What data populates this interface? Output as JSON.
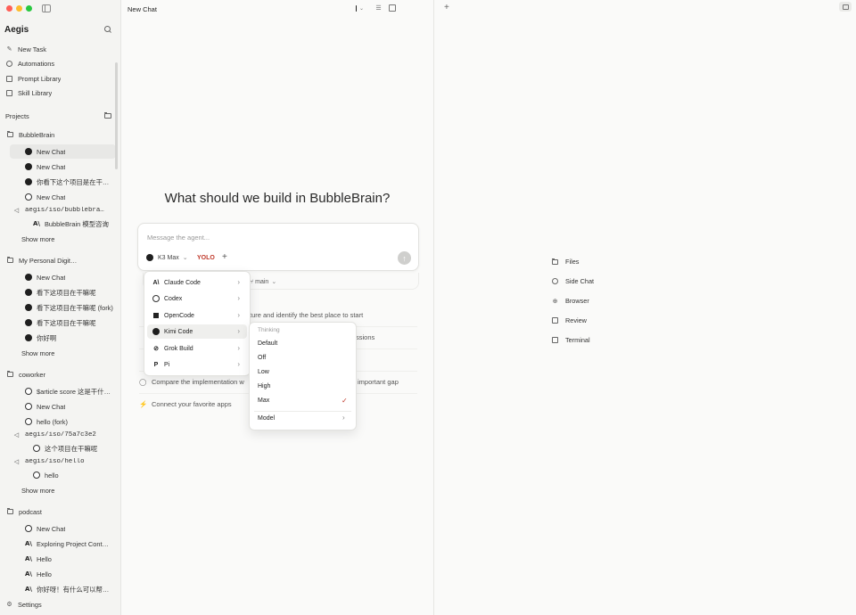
{
  "app": {
    "name": "Aegis"
  },
  "nav": [
    "New Task",
    "Automations",
    "Prompt Library",
    "Skill Library"
  ],
  "projects_label": "Projects",
  "sidebar": {
    "bubblebrain": {
      "name": "BubbleBrain",
      "chats": [
        "New Chat",
        "New Chat",
        "你看下这个项目是在干嘛呢",
        "New Chat"
      ],
      "worktree": "aegis/iso/bubblebra…",
      "worktree_chat": "BubbleBrain 模型咨询",
      "show_more": "Show more"
    },
    "personal": {
      "name": "My Personal Digit…",
      "chats": [
        "New Chat",
        "看下这项目在干嘛呢",
        "看下这项目在干嘛呢 (fork)",
        "看下这项目在干嘛呢",
        "你好啊"
      ],
      "show_more": "Show more"
    },
    "coworker": {
      "name": "coworker",
      "chats": [
        "$article score 这是干什…",
        "New Chat",
        "hello (fork)"
      ],
      "worktree1": "aegis/iso/75a7c3e2",
      "worktree1_chat": "这个项目在干嘛呢",
      "worktree2": "aegis/iso/hello",
      "worktree2_chat": "hello",
      "show_more": "Show more"
    },
    "podcast": {
      "name": "podcast",
      "chats": [
        "New Chat",
        "Exploring Project Cont…",
        "Hello",
        "Hello",
        "你好呀！有什么可以帮你…"
      ]
    },
    "settings": "Settings"
  },
  "header": {
    "title": "New Chat"
  },
  "hero": {
    "title": "What should we build in BubbleBrain?"
  },
  "composer": {
    "placeholder": "Message the agent...",
    "model": "K3 Max",
    "mode": "YOLO",
    "plus": "+",
    "branch": "main"
  },
  "suggestions": [
    "ture and identify the best place to start",
    "ssions",
    "",
    "Compare the implementation w",
    "Connect your favorite apps"
  ],
  "suggestion_tail": "important gap",
  "agent_menu": [
    "Claude Code",
    "Codex",
    "OpenCode",
    "Kimi Code",
    "Grok Build",
    "Pi"
  ],
  "thinking_menu": {
    "heading": "Thinking",
    "options": [
      "Default",
      "Off",
      "Low",
      "High",
      "Max"
    ],
    "selected": "Max",
    "model_label": "Model"
  },
  "right_panel": [
    "Files",
    "Side Chat",
    "Browser",
    "Review",
    "Terminal"
  ],
  "colors": {
    "accent": "#c0392b",
    "sidebar_bg": "#f4f4f2"
  }
}
